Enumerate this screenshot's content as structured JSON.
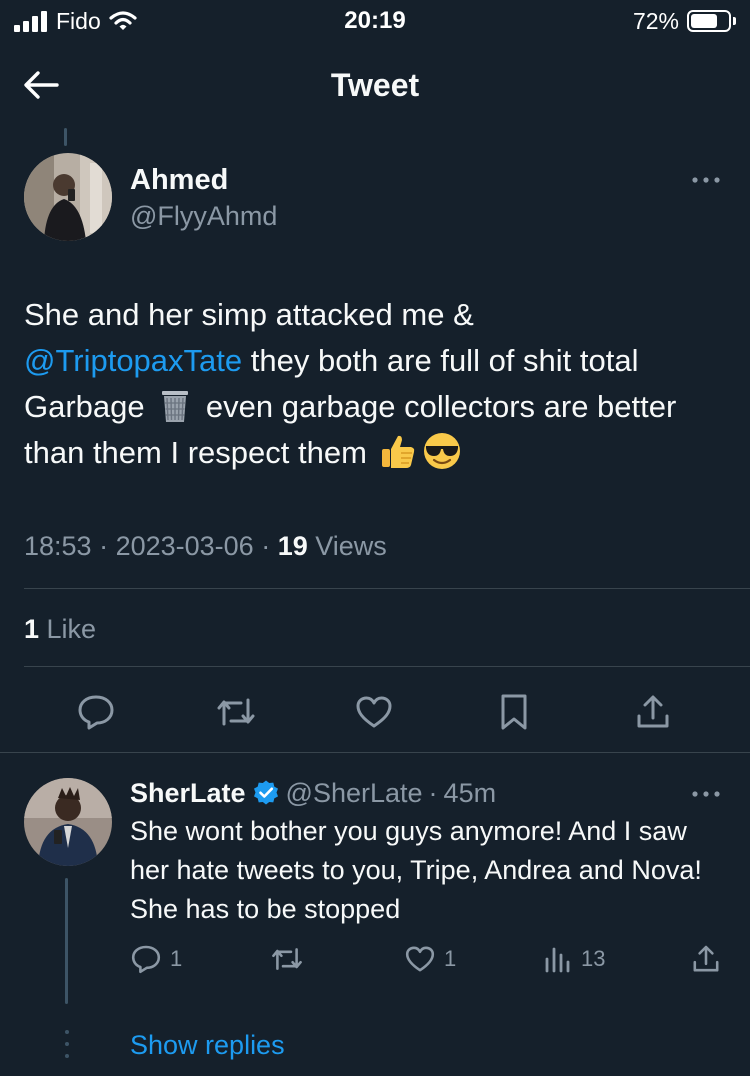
{
  "status_bar": {
    "carrier": "Fido",
    "time": "20:19",
    "battery": "72%",
    "battery_level": 0.72
  },
  "header": {
    "title": "Tweet"
  },
  "tweet": {
    "author_name": "Ahmed",
    "author_handle": "@FlyyAhmd",
    "text_part1": "She and her simp attacked me &",
    "mention": "@TriptopaxTate",
    "text_part2": " they both are full of shit total Garbage ",
    "text_part3": " even garbage collectors are better than them I respect them ",
    "time": "18:53",
    "sep1": " · ",
    "date": "2023-03-06",
    "sep2": " · ",
    "views_count": "19",
    "views_label": " Views",
    "likes_count": "1",
    "likes_label": " Like",
    "emojis": [
      "wastebasket-emoji",
      "thumbs-up-emoji",
      "sunglasses-emoji"
    ]
  },
  "reply": {
    "author_name": "SherLate",
    "author_handle": "@SherLate",
    "dot": "·",
    "time": "45m",
    "text": "She wont bother you guys anymore! And I saw her hate tweets to you, Tripe, Andrea and Nova! She has to be stopped",
    "reply_count": "1",
    "retweet_count": "",
    "like_count": "1",
    "views_count": "13",
    "verified": true
  },
  "show_replies_label": "Show replies",
  "colors": {
    "background": "#15202b",
    "accent": "#1d9bf0",
    "muted": "#8b98a5",
    "divider": "#38444d"
  }
}
